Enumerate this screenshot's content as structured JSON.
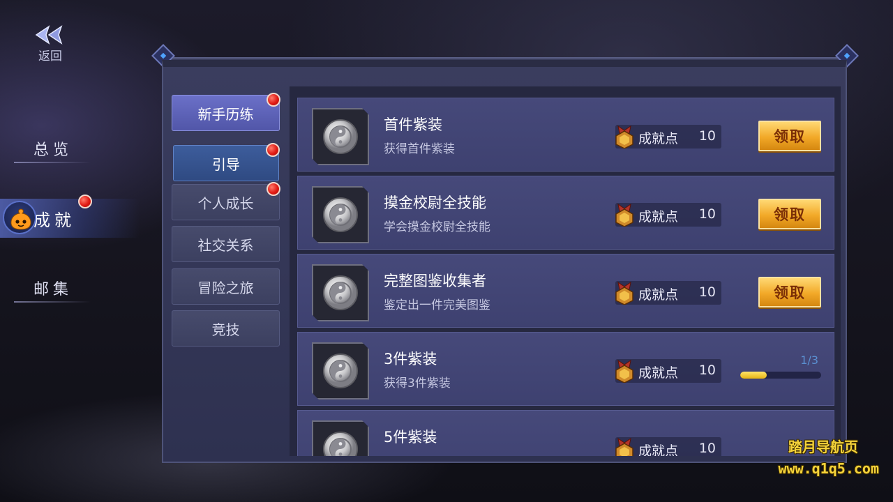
{
  "back": {
    "label": "返回"
  },
  "main_nav": {
    "items": [
      {
        "label": "总览",
        "active": false,
        "badge": false
      },
      {
        "label": "成就",
        "active": true,
        "badge": true
      },
      {
        "label": "邮集",
        "active": false,
        "badge": false
      }
    ]
  },
  "sub_tabs": [
    {
      "label": "新手历练",
      "state": "active-top",
      "badge": true
    },
    {
      "label": "引导",
      "state": "active-sub",
      "badge": true
    },
    {
      "label": "个人成长",
      "state": "normal",
      "badge": true
    },
    {
      "label": "社交关系",
      "state": "normal",
      "badge": false
    },
    {
      "label": "冒险之旅",
      "state": "normal",
      "badge": false
    },
    {
      "label": "竞技",
      "state": "normal",
      "badge": false
    }
  ],
  "achievements": [
    {
      "title": "首件紫装",
      "desc": "获得首件紫装",
      "points_label": "成就点",
      "points": "10",
      "action": "claim",
      "claim_label": "领取"
    },
    {
      "title": "摸金校尉全技能",
      "desc": "学会摸金校尉全技能",
      "points_label": "成就点",
      "points": "10",
      "action": "claim",
      "claim_label": "领取"
    },
    {
      "title": "完整图鉴收集者",
      "desc": "鉴定出一件完美图鉴",
      "points_label": "成就点",
      "points": "10",
      "action": "claim",
      "claim_label": "领取"
    },
    {
      "title": "3件紫装",
      "desc": "获得3件紫装",
      "points_label": "成就点",
      "points": "10",
      "action": "progress",
      "progress_text": "1/3",
      "progress": 0.33
    },
    {
      "title": "5件紫装",
      "desc": "",
      "points_label": "成就点",
      "points": "10",
      "action": "none"
    }
  ],
  "watermark": {
    "line1": "踏月导航页",
    "line2": "www.q1q5.com"
  },
  "colors": {
    "claim_button": "#f2a928",
    "progress_fill": "#e6b413",
    "badge_red": "#e01a14",
    "active_tab": "#6b70c8"
  }
}
